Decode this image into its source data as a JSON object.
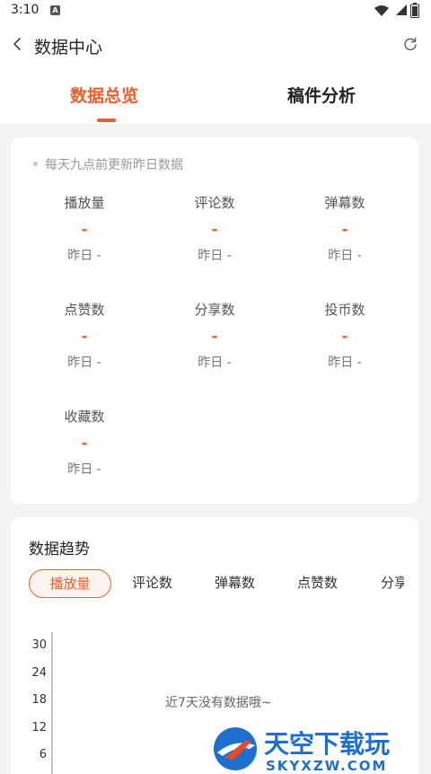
{
  "status_bar": {
    "time": "3:10",
    "notification_icon": "app-a-icon",
    "wifi_icon": "wifi-icon",
    "signal_icon": "signal-icon",
    "battery_icon": "battery-icon"
  },
  "header": {
    "title": "数据中心",
    "back_icon": "chevron-left-icon",
    "refresh_icon": "refresh-icon",
    "tabs": [
      {
        "label": "数据总览",
        "active": true
      },
      {
        "label": "稿件分析",
        "active": false
      }
    ]
  },
  "overview": {
    "notice": "每天九点前更新昨日数据",
    "metrics": [
      {
        "label": "播放量",
        "value": "-",
        "yesterday": "昨日 -"
      },
      {
        "label": "评论数",
        "value": "-",
        "yesterday": "昨日 -"
      },
      {
        "label": "弹幕数",
        "value": "-",
        "yesterday": "昨日 -"
      },
      {
        "label": "点赞数",
        "value": "-",
        "yesterday": "昨日 -"
      },
      {
        "label": "分享数",
        "value": "-",
        "yesterday": "昨日 -"
      },
      {
        "label": "投币数",
        "value": "-",
        "yesterday": "昨日 -"
      },
      {
        "label": "收藏数",
        "value": "-",
        "yesterday": "昨日 -"
      }
    ]
  },
  "trend": {
    "title": "数据趋势",
    "chips": [
      {
        "label": "播放量",
        "active": true
      },
      {
        "label": "评论数",
        "active": false
      },
      {
        "label": "弹幕数",
        "active": false
      },
      {
        "label": "点赞数",
        "active": false
      },
      {
        "label": "分享数",
        "active": false
      }
    ],
    "empty_text": "近7天没有数据哦~",
    "y_ticks": [
      "30",
      "24",
      "18",
      "12",
      "6"
    ]
  },
  "watermark": {
    "brand_cn": "天空下载玩",
    "brand_en": "SKYXZW.COM"
  },
  "colors": {
    "accent": "#f25d2e",
    "background": "#f4f4f4",
    "card": "#ffffff"
  }
}
